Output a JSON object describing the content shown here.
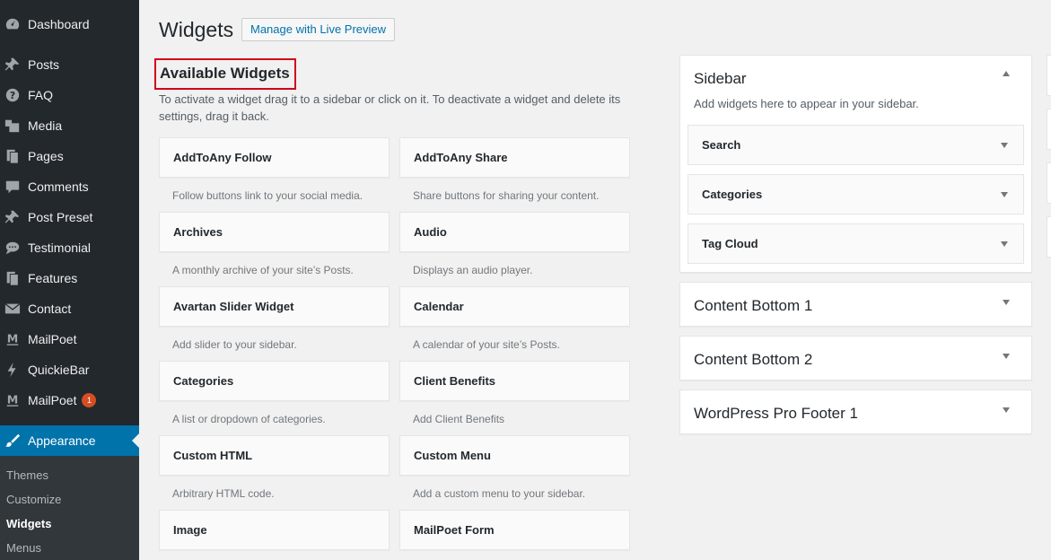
{
  "menu": {
    "items": [
      {
        "label": "Dashboard",
        "icon": "dashboard-icon"
      },
      {
        "label": "Posts",
        "icon": "pin-icon"
      },
      {
        "label": "FAQ",
        "icon": "question-icon"
      },
      {
        "label": "Media",
        "icon": "media-icon"
      },
      {
        "label": "Pages",
        "icon": "pages-icon"
      },
      {
        "label": "Comments",
        "icon": "comment-icon"
      },
      {
        "label": "Post Preset",
        "icon": "pin-icon"
      },
      {
        "label": "Testimonial",
        "icon": "speech-bubble-icon"
      },
      {
        "label": "Features",
        "icon": "pages-icon"
      },
      {
        "label": "Contact",
        "icon": "envelope-icon"
      },
      {
        "label": "MailPoet",
        "icon": "mailpoet-icon"
      },
      {
        "label": "QuickieBar",
        "icon": "lightning-icon"
      },
      {
        "label": "MailPoet",
        "icon": "mailpoet-icon",
        "badge": "1"
      },
      {
        "label": "Appearance",
        "icon": "paintbrush-icon",
        "active": true
      }
    ],
    "submenu": [
      "Themes",
      "Customize",
      "Widgets",
      "Menus"
    ],
    "submenu_current": "Widgets",
    "accent_color": "#0073aa"
  },
  "header": {
    "title": "Widgets",
    "live_preview_label": "Manage with Live Preview"
  },
  "available": {
    "title": "Available Widgets",
    "description": "To activate a widget drag it to a sidebar or click on it. To deactivate a widget and delete its settings, drag it back.",
    "widgets": [
      {
        "name": "AddToAny Follow",
        "desc": "Follow buttons link to your social media."
      },
      {
        "name": "AddToAny Share",
        "desc": "Share buttons for sharing your content."
      },
      {
        "name": "Archives",
        "desc": "A monthly archive of your site’s Posts."
      },
      {
        "name": "Audio",
        "desc": "Displays an audio player."
      },
      {
        "name": "Avartan Slider Widget",
        "desc": "Add slider to your sidebar."
      },
      {
        "name": "Calendar",
        "desc": "A calendar of your site’s Posts."
      },
      {
        "name": "Categories",
        "desc": "A list or dropdown of categories."
      },
      {
        "name": "Client Benefits",
        "desc": "Add Client Benefits"
      },
      {
        "name": "Custom HTML",
        "desc": "Arbitrary HTML code."
      },
      {
        "name": "Custom Menu",
        "desc": "Add a custom menu to your sidebar."
      },
      {
        "name": "Image",
        "desc": ""
      },
      {
        "name": "MailPoet Form",
        "desc": ""
      }
    ]
  },
  "sidebars": {
    "main": {
      "title": "Sidebar",
      "description": "Add widgets here to appear in your sidebar.",
      "widgets": [
        "Search",
        "Categories",
        "Tag Cloud"
      ]
    },
    "others": [
      "Content Bottom 1",
      "Content Bottom 2",
      "WordPress Pro Footer 1"
    ]
  },
  "highlight_color": "#d0021b"
}
